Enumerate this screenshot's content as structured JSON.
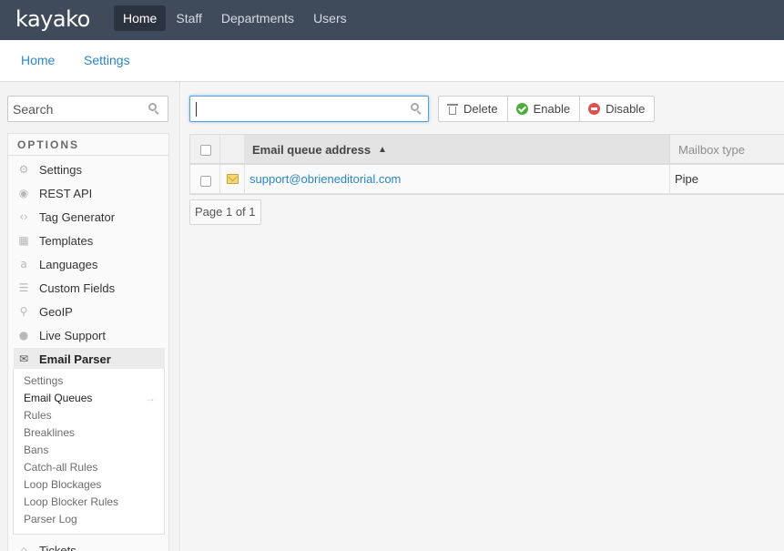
{
  "app": {
    "logo": "kayako"
  },
  "topnav": {
    "items": [
      {
        "label": "Home",
        "active": true
      },
      {
        "label": "Staff",
        "active": false
      },
      {
        "label": "Departments",
        "active": false
      },
      {
        "label": "Users",
        "active": false
      }
    ]
  },
  "subnav": {
    "items": [
      {
        "label": "Home"
      },
      {
        "label": "Settings"
      }
    ]
  },
  "sidebar": {
    "search": {
      "placeholder": "Search",
      "value": ""
    },
    "options_title": "OPTIONS",
    "items": [
      {
        "label": "Settings",
        "icon": "gear-icon"
      },
      {
        "label": "REST API",
        "icon": "broadcast-icon"
      },
      {
        "label": "Tag Generator",
        "icon": "code-icon"
      },
      {
        "label": "Templates",
        "icon": "template-icon"
      },
      {
        "label": "Languages",
        "icon": "language-icon"
      },
      {
        "label": "Custom Fields",
        "icon": "list-icon"
      },
      {
        "label": "GeoIP",
        "icon": "map-pin-icon"
      },
      {
        "label": "Live Support",
        "icon": "chat-icon"
      },
      {
        "label": "Email Parser",
        "icon": "envelope-icon",
        "expanded": true
      },
      {
        "label": "Tickets",
        "icon": "ticket-icon"
      }
    ],
    "email_parser_sub": [
      {
        "label": "Settings",
        "active": false
      },
      {
        "label": "Email Queues",
        "active": true
      },
      {
        "label": "Rules",
        "active": false
      },
      {
        "label": "Breaklines",
        "active": false
      },
      {
        "label": "Bans",
        "active": false
      },
      {
        "label": "Catch-all Rules",
        "active": false
      },
      {
        "label": "Loop Blockages",
        "active": false
      },
      {
        "label": "Loop Blocker Rules",
        "active": false
      },
      {
        "label": "Parser Log",
        "active": false
      }
    ],
    "active_arrow": "→"
  },
  "main": {
    "filter": {
      "value": "",
      "placeholder": ""
    },
    "toolbar": {
      "delete": "Delete",
      "enable": "Enable",
      "disable": "Disable"
    },
    "grid": {
      "columns": {
        "email": "Email queue address",
        "sort_indicator": "▲",
        "mailbox": "Mailbox type"
      },
      "rows": [
        {
          "email": "support@obrieneditorial.com",
          "mailbox_type": "Pipe"
        }
      ]
    },
    "pager": "Page 1 of 1"
  }
}
